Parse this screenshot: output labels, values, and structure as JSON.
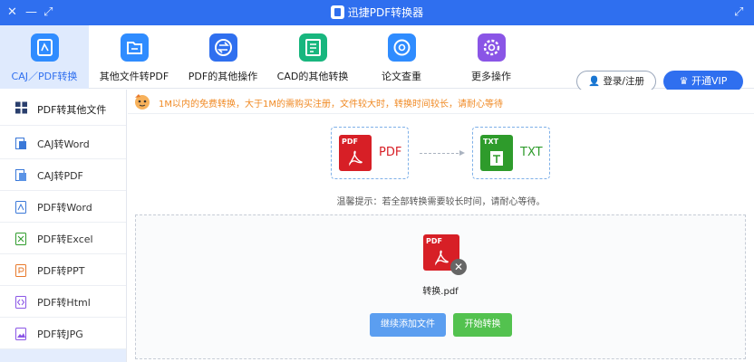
{
  "window": {
    "title": "迅捷PDF转换器",
    "controls": [
      "✕",
      "—",
      "⤢"
    ],
    "restore": "⤢"
  },
  "toolbar": {
    "tools": [
      {
        "label": "CAJ／PDF转换",
        "icon": "pdf-convert-icon",
        "color": "#2f8cff"
      },
      {
        "label": "其他文件转PDF",
        "icon": "folder-file-icon",
        "color": "#2f8cff"
      },
      {
        "label": "PDF的其他操作",
        "icon": "swap-arrows-icon",
        "color": "#2f6fef"
      },
      {
        "label": "CAD的其他转换",
        "icon": "cad-file-icon",
        "color": "#18b67e"
      },
      {
        "label": "论文查重",
        "icon": "at-search-icon",
        "color": "#2f8cff"
      },
      {
        "label": "更多操作",
        "icon": "gear-icon",
        "color": "#8a55e6"
      }
    ],
    "login_label": "登录/注册",
    "vip_label": "开通VIP"
  },
  "sidebar": {
    "items": [
      {
        "label": "PDF转其他文件",
        "icon": "grid-icon"
      },
      {
        "label": "CAJ转Word",
        "icon": "caj-word-icon"
      },
      {
        "label": "CAJ转PDF",
        "icon": "caj-pdf-icon"
      },
      {
        "label": "PDF转Word",
        "icon": "pdf-word-icon"
      },
      {
        "label": "PDF转Excel",
        "icon": "pdf-excel-icon"
      },
      {
        "label": "PDF转PPT",
        "icon": "pdf-ppt-icon"
      },
      {
        "label": "PDF转Html",
        "icon": "pdf-html-icon"
      },
      {
        "label": "PDF转JPG",
        "icon": "pdf-jpg-icon"
      }
    ]
  },
  "notice": {
    "text": "1M以内的免费转换，大于1M的需购买注册，文件较大时，转换时间较长，请耐心等待"
  },
  "conversion": {
    "from": {
      "badge": "PDF",
      "name": "PDF",
      "color": "#d71f26"
    },
    "to": {
      "badge": "TXT",
      "name": "TXT",
      "color": "#2e9b2b"
    },
    "tip": "温馨提示：若全部转换需要较长时间，请耐心等待。"
  },
  "file": {
    "badge": "PDF",
    "name": "转换.pdf",
    "remove": "✕"
  },
  "actions": {
    "add_label": "继续添加文件",
    "start_label": "开始转换"
  },
  "colors": {
    "brand_blue": "#2f6fef",
    "warning_orange": "#f08a24",
    "start_green": "#53c24f"
  }
}
